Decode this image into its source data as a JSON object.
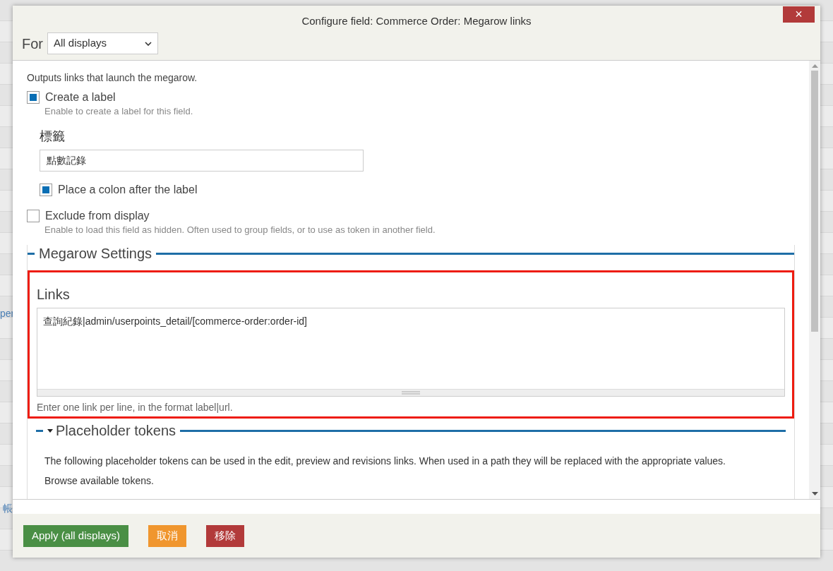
{
  "background": {
    "left_fragments": [
      "per",
      "帳"
    ]
  },
  "dialog": {
    "title": "Configure field: Commerce Order: Megarow links",
    "close": "×",
    "for_label": "For",
    "for_select": "All displays",
    "description": "Outputs links that launch the megarow.",
    "create_label": {
      "label": "Create a label",
      "checked": true,
      "help": "Enable to create a label for this field."
    },
    "label_field": {
      "label": "標籤",
      "value": "點數記錄"
    },
    "colon": {
      "label": "Place a colon after the label",
      "checked": true
    },
    "exclude": {
      "label": "Exclude from display",
      "checked": false,
      "help": "Enable to load this field as hidden. Often used to group fields, or to use as token in another field."
    },
    "megarow_settings": {
      "legend": "Megarow Settings",
      "links_label": "Links",
      "links_value": "查詢紀錄|admin/userpoints_detail/[commerce-order:order-id]",
      "links_help": "Enter one link per line, in the format label|url."
    },
    "placeholder_tokens": {
      "legend": "Placeholder tokens",
      "expanded": true,
      "text": "The following placeholder tokens can be used in the edit, preview and revisions links. When used in a path they will be replaced with the appropriate values.",
      "browse": "Browse available tokens."
    },
    "buttons": [
      {
        "label": "Apply (all displays)",
        "kind": "primary"
      },
      {
        "label": "取消",
        "kind": "cancel"
      },
      {
        "label": "移除",
        "kind": "danger"
      }
    ]
  }
}
